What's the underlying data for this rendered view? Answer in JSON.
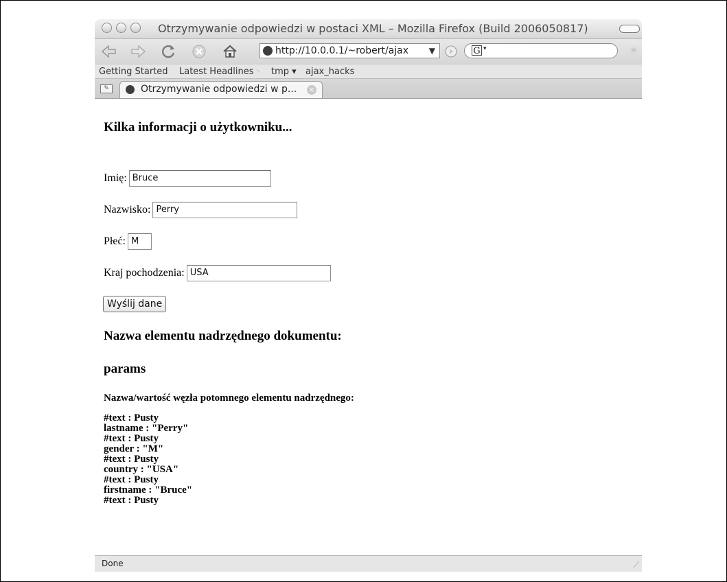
{
  "window": {
    "title": "Otrzymywanie odpowiedzi w postaci XML – Mozilla Firefox (Build 2006050817)"
  },
  "toolbar": {
    "icons": [
      "back-icon",
      "forward-icon",
      "reload-icon",
      "stop-icon",
      "home-icon"
    ],
    "url": "http://10.0.0.1/~robert/ajax",
    "search_engine_glyph": "G"
  },
  "bookmarks": {
    "items": [
      {
        "label": "Getting Started"
      },
      {
        "label": "Latest Headlines"
      },
      {
        "label": "tmp ▾"
      },
      {
        "label": "ajax_hacks"
      }
    ]
  },
  "tabs": [
    {
      "label": "Otrzymywanie odpowiedzi w p..."
    }
  ],
  "page": {
    "heading": "Kilka informacji o użytkowniku...",
    "form": {
      "first_name": {
        "label": "Imię:",
        "value": "Bruce"
      },
      "last_name": {
        "label": "Nazwisko:",
        "value": "Perry"
      },
      "gender": {
        "label": "Płeć:",
        "value": "M"
      },
      "country": {
        "label": "Kraj pochodzenia:",
        "value": "USA"
      },
      "submit_label": "Wyślij dane"
    },
    "root_heading": "Nazwa elementu nadrzędnego dokumentu:",
    "root_name": "params",
    "children_heading": "Nazwa/wartość węzła potomnego elementu nadrzędnego:",
    "child_nodes": [
      "#text : Pusty",
      "lastname : \"Perry\"",
      "#text : Pusty",
      "gender : \"M\"",
      "#text : Pusty",
      "country : \"USA\"",
      "#text : Pusty",
      "firstname : \"Bruce\"",
      "#text : Pusty"
    ]
  },
  "status": {
    "text": "Done"
  }
}
